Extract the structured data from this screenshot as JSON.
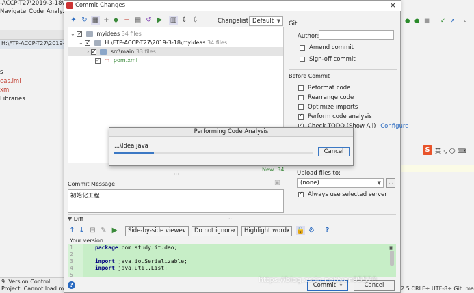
{
  "ide": {
    "title_fragment": "-ACCP-T27\\2019-3-18\\m",
    "menu": [
      "Navigate",
      "Code",
      "Analyz"
    ],
    "path_fragment": "H:\\FTP-ACCP-T27\\2019-",
    "tree": [
      "s",
      "eas.iml",
      "xml",
      "Libraries"
    ],
    "bottom_tab": "9: Version Control",
    "status_text": "Project: Cannot load mo",
    "right_status": "2:5  CRLF÷  UTF-8÷  Git: ma",
    "ime": "英 ·, ☺ ⌨"
  },
  "dialog": {
    "title": "Commit Changes",
    "close": "×",
    "changelist_label": "Changelist:",
    "changelist_value": "Default",
    "tree": [
      {
        "label": "myideas",
        "count": "34 files"
      },
      {
        "label": "H:\\FTP-ACCP-T27\\2019-3-18\\myideas",
        "count": "34 files"
      },
      {
        "label": "src\\main",
        "count": "33 files"
      },
      {
        "label": "pom.xml",
        "count": ""
      }
    ],
    "new_count": "New: 34",
    "commit_message_label": "Commit Message",
    "commit_message": "初始化工程",
    "diff_label": "Diff",
    "diff_viewer": "Side-by-side viewer",
    "diff_ignore": "Do not ignore",
    "diff_highlight": "Highlight words",
    "your_version": "Your version",
    "code_lines": [
      {
        "n": "1",
        "kw": "package",
        "rest": " com.study.it.dao;"
      },
      {
        "n": "2",
        "kw": "",
        "rest": ""
      },
      {
        "n": "3",
        "kw": "import",
        "rest": " java.io.Serializable;"
      },
      {
        "n": "4",
        "kw": "import",
        "rest": " java.util.List;"
      },
      {
        "n": "5",
        "kw": "",
        "rest": ""
      }
    ],
    "git_label": "Git",
    "author_label": "Author:",
    "amend_commit": "Amend commit",
    "signoff_commit": "Sign-off commit",
    "before_commit_label": "Before Commit",
    "before_commit_opts": [
      {
        "label": "Reformat code",
        "checked": false
      },
      {
        "label": "Rearrange code",
        "checked": false
      },
      {
        "label": "Optimize imports",
        "checked": false
      },
      {
        "label": "Perform code analysis",
        "checked": true
      },
      {
        "label": "Check TODO (Show All)",
        "checked": true
      }
    ],
    "configure": "Configure",
    "upload_label": "Upload files to:",
    "upload_value": "(none)",
    "upload_more": "...",
    "always_use_server": "Always use selected server",
    "commit_button": "Commit",
    "cancel_button": "Cancel",
    "help": "?"
  },
  "modal": {
    "title": "Performing Code Analysis",
    "file": "...\\Idea.java",
    "progress": 0.2,
    "cancel": "Cancel"
  },
  "watermark": "https://blog.csdn.net/yan95520",
  "colors": {
    "accent": "#3b78c4",
    "diff_bg": "#c7eec7",
    "new_count": "#3a8a3a"
  }
}
